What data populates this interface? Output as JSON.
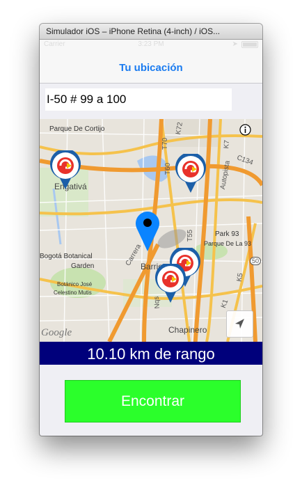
{
  "window": {
    "title": "Simulador iOS – iPhone Retina (4-inch) / iOS..."
  },
  "status_bar": {
    "carrier": "Carrier",
    "time": "3:23 PM"
  },
  "nav": {
    "title": "Tu ubicación"
  },
  "search": {
    "value": "I-50 # 99 a 100"
  },
  "map": {
    "labels": {
      "parque_cortijo": "Parque De Cortijo",
      "engativa": "Engativá",
      "bogota_botanical": "Bogotá Botanical",
      "garden": "Garden",
      "botanico_1": "Botánico José",
      "botanico_2": "Celestino Mutis",
      "park93": "Park 93",
      "parque93": "Parque De La 93",
      "barrios": "Barrios",
      "chapinero": "Chapinero",
      "autopista": "Autopista",
      "carrera": "Carrera",
      "google": "Google",
      "road_k72": "K72",
      "road_t70": "T70",
      "road_t60": "T60",
      "road_c134": "C134",
      "road_k7": "K7",
      "road_k1": "K1",
      "road_k5": "K5",
      "road_t55": "T55",
      "road_nqs": "Nqs",
      "road_50": "50"
    },
    "markers": [
      "station-logo",
      "station-logo",
      "station-logo",
      "station-logo"
    ],
    "current_location_pin": "blue-location-pin"
  },
  "range": {
    "text": "10.10 km de rango"
  },
  "actions": {
    "find_label": "Encontrar"
  },
  "colors": {
    "nav_title": "#1a7bf0",
    "range_bar": "#00007b",
    "find_button": "#2bff2b",
    "pin": "#0a84ff",
    "marker_ring": "#1c5fa8"
  }
}
